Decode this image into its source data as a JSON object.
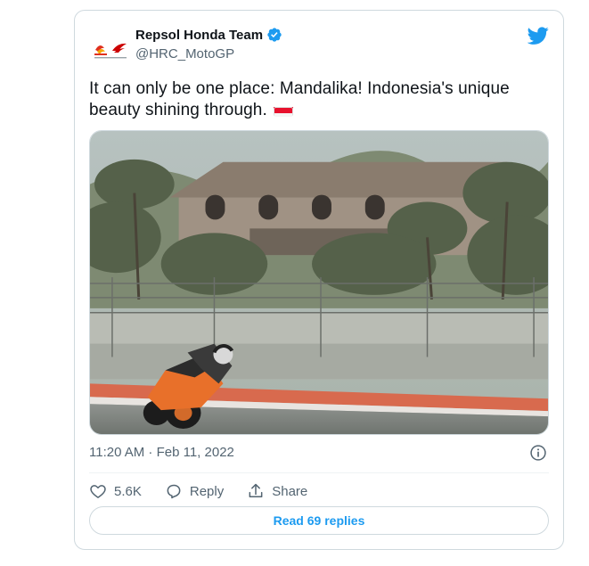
{
  "account": {
    "display_name": "Repsol Honda Team",
    "handle": "@HRC_MotoGP",
    "verified_icon": "verified-badge-icon",
    "avatar_icon": "repsol-honda-logo"
  },
  "tweet": {
    "text": "It can only be one place: Mandalika! Indonesia's unique beauty shining through.",
    "emoji": "indonesia-flag",
    "timestamp": "11:20 AM · Feb 11, 2022"
  },
  "actions": {
    "like_count": "5.6K",
    "reply_label": "Reply",
    "share_label": "Share"
  },
  "footer": {
    "read_replies_label": "Read 69 replies"
  },
  "colors": {
    "twitter_blue": "#1d9bf0",
    "secondary_text": "#536471",
    "border": "#cfd9de"
  }
}
